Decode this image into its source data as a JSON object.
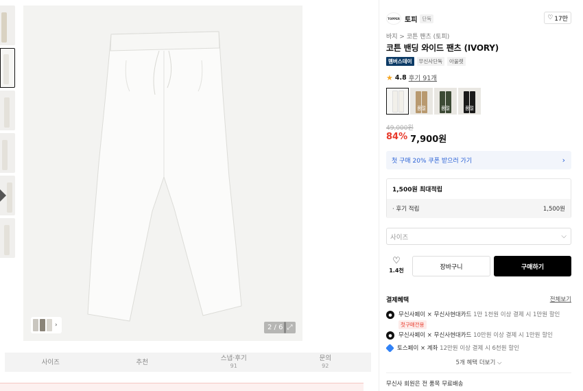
{
  "product": {
    "brand_logo": "TOPPER",
    "brand_name": "토피",
    "brand_tag": "단독",
    "likes": "17만",
    "breadcrumb": "바지 > 코튼 팬츠 (토피)",
    "title": "코튼 밴딩 와이드 팬츠 (IVORY)",
    "badge_member": "멤버스데이",
    "badge_exclusive": "무신사단독",
    "badge_outlet": "아울렛",
    "rating": "4.8",
    "review_text": "후기 91개",
    "original_price": "49,000원",
    "discount": "84%",
    "price": "7,900원"
  },
  "gallery": {
    "counter": "2 / 6"
  },
  "color_options": [
    {
      "label": "",
      "color": "#f2f0ea"
    },
    {
      "label": "품절",
      "color": "#b8996f"
    },
    {
      "label": "품절",
      "color": "#3d4a35"
    },
    {
      "label": "품절",
      "color": "#1a1a1a"
    }
  ],
  "coupon": {
    "text": "첫 구매 20% 쿠폰 받으러 가기"
  },
  "points": {
    "max_label": "1,500원 최대적립",
    "review_label": "· 후기 적립",
    "review_value": "1,500원"
  },
  "size_select": {
    "placeholder": "사이즈"
  },
  "actions": {
    "wish_count": "1.4천",
    "cart_label": "장바구니",
    "buy_label": "구매하기"
  },
  "payment": {
    "heading": "결제혜택",
    "view_all": "전체보기",
    "rows": [
      {
        "prefix": "무신사페이 × 무신사현대카드",
        "detail": " 1만 1천원 이상 결제 시 1만원 할인",
        "chip": "첫구매전용"
      },
      {
        "prefix": "무신사페이 × 무신사현대카드",
        "detail": " 10만원 이상 결제 시 1만원 할인",
        "chip": ""
      },
      {
        "prefix": "토스페이 × 계좌",
        "detail": " 12만원 이상 결제 시 6천원 할인",
        "chip": ""
      }
    ],
    "more": "5개 혜택 더보기 ⌵"
  },
  "shipping": {
    "text": "무신사 회원은 전 품목 무료배송"
  },
  "tabs": [
    {
      "label": "사이즈",
      "sub": ""
    },
    {
      "label": "추천",
      "sub": ""
    },
    {
      "label": "스냅·후기",
      "sub": "91"
    },
    {
      "label": "문의",
      "sub": "92"
    }
  ]
}
